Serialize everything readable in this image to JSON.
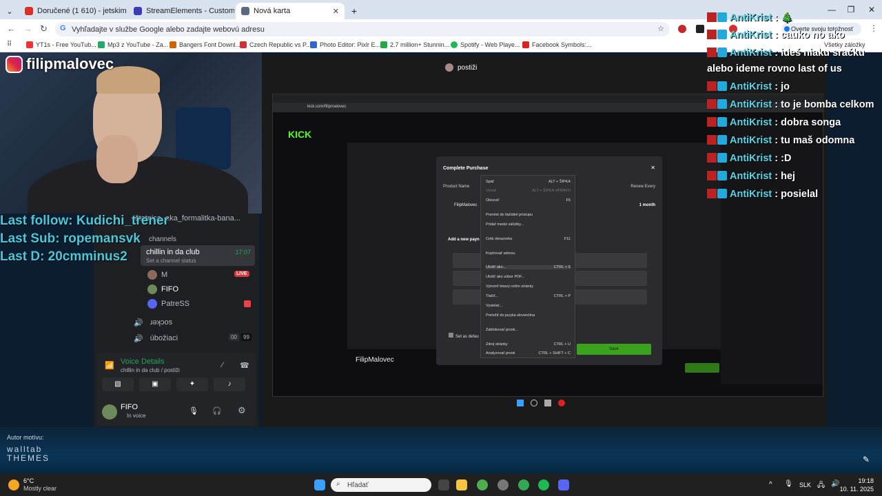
{
  "browser": {
    "tabs": [
      {
        "title": "Doručené (1 610) - jetskimalov",
        "favicon_color": "#d93025"
      },
      {
        "title": "StreamElements - Custom comm",
        "favicon_color": "#3b3bb3"
      },
      {
        "title": "Nová karta",
        "favicon_color": "#5a6b80"
      }
    ],
    "omnibox_placeholder": "Vyhľadajte v službe Google alebo zadajte webovú adresu",
    "profile_pill": "Overte svoju totožnosť",
    "bookmarks": [
      {
        "label": "YT1s - Free YouTub...",
        "color": "#e33"
      },
      {
        "label": "Mp3 z YouTube - Za...",
        "color": "#2a6"
      },
      {
        "label": "Bangers Font Downl...",
        "color": "#c60"
      },
      {
        "label": "Czech Republic vs P...",
        "color": "#c33"
      },
      {
        "label": "Photo Editor: Pixlr E...",
        "color": "#36c"
      },
      {
        "label": "2.7 million+ Stunnin...",
        "color": "#2a4"
      },
      {
        "label": "Spotify - Web Playe...",
        "color": "#1db954"
      },
      {
        "label": "Facebook Symbols:...",
        "color": "#d22"
      }
    ],
    "all_bookmarks": "Všetky záložky"
  },
  "stream_overlay": {
    "instagram_handle": "filipmalovec",
    "last_follow": "Last follow: Kudichi_trener",
    "last_sub": "Last Sub: ropemansvk",
    "last_d": "Last D: 20cmminus2"
  },
  "discord": {
    "channel_top": "štatnica_aka_formalitka-bana...",
    "channels_header": "channels",
    "voice_channel": "chillin in da club",
    "voice_time": "17:07",
    "set_status": "Set a channel status",
    "members": [
      {
        "name": "M",
        "badge": "LIVE"
      },
      {
        "name": "FIFO",
        "badge": ""
      },
      {
        "name": "PatreSS",
        "badge": ""
      }
    ],
    "other_channel_1": "ɹǝʞɔos",
    "other_channel_2": "úbožiaci",
    "other_channel_2_counts": [
      "00",
      "99"
    ],
    "voice_details_title": "Voice Details",
    "voice_details_sub": "chillin in da club / postiži",
    "user_name": "FIFO",
    "user_status": "In voice"
  },
  "screen_share": {
    "title": "postiži",
    "modal_title": "Complete Purchase",
    "product_label": "Product Name",
    "renew_label": "Renew Every",
    "product_value": "FilipMalovec",
    "renew_value": "1 month",
    "add_payment": "Add a new payn",
    "set_default": "Set as defau",
    "save_btn": "Save",
    "context_menu": [
      {
        "label": "Späť",
        "shortcut": "ALT + ŠÍPKA"
      },
      {
        "label": "Vpred",
        "shortcut": "ALT + ŠÍPKA VPRAVO"
      },
      {
        "label": "Obnoviť",
        "shortcut": "F5"
      },
      {
        "label": "Prenést do tlačidiel prístupu",
        "shortcut": ""
      },
      {
        "label": "Pridať medzi záložky...",
        "shortcut": ""
      },
      {
        "label": "Celá obrazovka",
        "shortcut": "F11"
      },
      {
        "label": "Kopírovať adresu",
        "shortcut": ""
      },
      {
        "label": "Uložiť ako...",
        "shortcut": "CTRL + S"
      },
      {
        "label": "Uložiť ako súbor PDF...",
        "shortcut": ""
      },
      {
        "label": "Vytvoriť tmavý režim stránky",
        "shortcut": ""
      },
      {
        "label": "Tlačiť...",
        "shortcut": "CTRL + P"
      },
      {
        "label": "Vysielať...",
        "shortcut": ""
      },
      {
        "label": "Preložiť do jazyka slovenčina",
        "shortcut": ""
      },
      {
        "label": "Zablokovať prvok...",
        "shortcut": ""
      },
      {
        "label": "Zdroj stránky",
        "shortcut": "CTRL + U"
      },
      {
        "label": "Analyzovať prvok",
        "shortcut": "CTRL + SHIFT + C"
      }
    ],
    "kick_url": "kick.com/filipmalovec",
    "kick_channel": "FilipMalovec"
  },
  "chat": [
    {
      "user": "AntiKrist",
      "msg": ": 🎄"
    },
    {
      "user": "AntiKrist",
      "msg": ": cauko no ako"
    },
    {
      "user": "AntiKrist",
      "msg": ": ideš niaku sračku"
    },
    {
      "user": "",
      "msg": "alebo ideme rovno last of us"
    },
    {
      "user": "AntiKrist",
      "msg": ": jo"
    },
    {
      "user": "AntiKrist",
      "msg": ": to je bomba celkom"
    },
    {
      "user": "AntiKrist",
      "msg": ": dobra songa"
    },
    {
      "user": "AntiKrist",
      "msg": ": tu maš odomna"
    },
    {
      "user": "AntiKrist",
      "msg": ": :D"
    },
    {
      "user": "AntiKrist",
      "msg": ": hej"
    },
    {
      "user": "AntiKrist",
      "msg": ": posielal"
    }
  ],
  "desktop": {
    "theme_author_label": "Autor motívu:",
    "theme_author": "walltab THEMES"
  },
  "taskbar": {
    "weather_temp": "6°C",
    "weather_desc": "Mostly clear",
    "search_placeholder": "Hľadať",
    "lang": "SLK",
    "time": "19:18",
    "date": "10. 11. 2025"
  }
}
